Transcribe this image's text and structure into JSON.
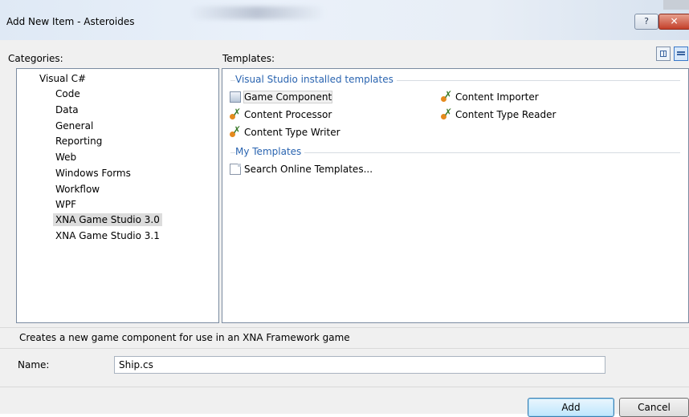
{
  "window": {
    "title": "Add New Item - Asteroides",
    "help_glyph": "?",
    "close_glyph": "✕"
  },
  "categories": {
    "label": "Categories:",
    "items": [
      {
        "label": "Visual C#",
        "level": 0
      },
      {
        "label": "Code",
        "level": 1
      },
      {
        "label": "Data",
        "level": 1
      },
      {
        "label": "General",
        "level": 1
      },
      {
        "label": "Reporting",
        "level": 1
      },
      {
        "label": "Web",
        "level": 1
      },
      {
        "label": "Windows Forms",
        "level": 1
      },
      {
        "label": "Workflow",
        "level": 1
      },
      {
        "label": "WPF",
        "level": 1
      },
      {
        "label": "XNA Game Studio 3.0",
        "level": 1,
        "selected": true
      },
      {
        "label": "XNA Game Studio 3.1",
        "level": 1
      }
    ]
  },
  "templates": {
    "label": "Templates:",
    "installed_header": "Visual Studio installed templates",
    "installed": [
      {
        "label": "Game Component",
        "icon": "game-component-icon",
        "selected": true
      },
      {
        "label": "Content Importer",
        "icon": "content-pipeline-icon"
      },
      {
        "label": "Content Processor",
        "icon": "content-pipeline-icon"
      },
      {
        "label": "Content Type Reader",
        "icon": "content-pipeline-icon"
      },
      {
        "label": "Content Type Writer",
        "icon": "content-pipeline-icon"
      }
    ],
    "my_header": "My Templates",
    "my": [
      {
        "label": "Search Online Templates...",
        "icon": "online-template-icon"
      }
    ],
    "views": [
      "large-icons-view",
      "small-icons-view"
    ],
    "active_view": "small-icons-view"
  },
  "description": "Creates a new game component for use in an XNA Framework game",
  "name_field": {
    "label": "Name:",
    "value": "Ship.cs"
  },
  "buttons": {
    "add": "Add",
    "cancel": "Cancel"
  }
}
